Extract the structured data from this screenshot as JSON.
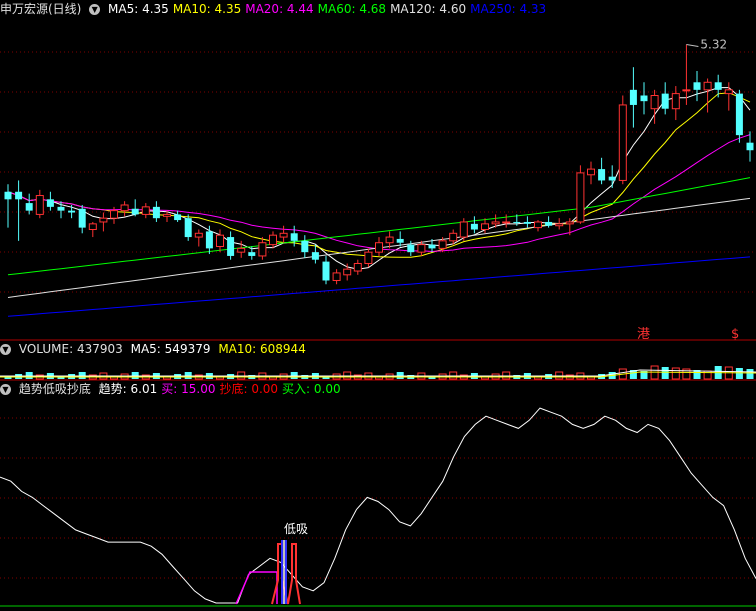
{
  "main": {
    "title": "申万宏源(日线)",
    "ma": [
      {
        "label": "MA5:",
        "value": "4.35",
        "color": "#ffffff"
      },
      {
        "label": "MA10:",
        "value": "4.35",
        "color": "#ffff00"
      },
      {
        "label": "MA20:",
        "value": "4.44",
        "color": "#ff00ff"
      },
      {
        "label": "MA60:",
        "value": "4.68",
        "color": "#00ff00"
      },
      {
        "label": "MA120:",
        "value": "4.60",
        "color": "#e0e0e0"
      },
      {
        "label": "MA250:",
        "value": "4.33",
        "color": "#0000ff"
      }
    ],
    "peak_label": "5.32",
    "badge_gang": "港",
    "badge_s": "$"
  },
  "volume": {
    "label": "VOLUME:",
    "value": "437903",
    "ma5_label": "MA5:",
    "ma5_value": "549379",
    "ma10_label": "MA10:",
    "ma10_value": "608944"
  },
  "indicator": {
    "title": "趋势低吸抄底",
    "items": [
      {
        "label": "趋势:",
        "value": "6.01",
        "color": "#ffffff"
      },
      {
        "label": "买:",
        "value": "15.00",
        "color": "#ff00ff"
      },
      {
        "label": "抄底:",
        "value": "0.00",
        "color": "#ff0000"
      },
      {
        "label": "买入:",
        "value": "0.00",
        "color": "#00ff00"
      }
    ],
    "signal_label": "低吸"
  },
  "chart_data": {
    "type": "candlestick",
    "candles": [
      {
        "o": 4.5,
        "h": 4.58,
        "l": 4.35,
        "c": 4.54,
        "up": false
      },
      {
        "o": 4.54,
        "h": 4.6,
        "l": 4.28,
        "c": 4.5,
        "up": false
      },
      {
        "o": 4.48,
        "h": 4.53,
        "l": 4.42,
        "c": 4.44,
        "up": false
      },
      {
        "o": 4.42,
        "h": 4.55,
        "l": 4.4,
        "c": 4.52,
        "up": true
      },
      {
        "o": 4.5,
        "h": 4.54,
        "l": 4.44,
        "c": 4.46,
        "up": false
      },
      {
        "o": 4.46,
        "h": 4.49,
        "l": 4.4,
        "c": 4.44,
        "up": false
      },
      {
        "o": 4.44,
        "h": 4.47,
        "l": 4.4,
        "c": 4.43,
        "up": false
      },
      {
        "o": 4.45,
        "h": 4.47,
        "l": 4.32,
        "c": 4.35,
        "up": false
      },
      {
        "o": 4.34,
        "h": 4.38,
        "l": 4.3,
        "c": 4.37,
        "up": true
      },
      {
        "o": 4.38,
        "h": 4.43,
        "l": 4.33,
        "c": 4.4,
        "up": true
      },
      {
        "o": 4.4,
        "h": 4.46,
        "l": 4.37,
        "c": 4.44,
        "up": true
      },
      {
        "o": 4.44,
        "h": 4.49,
        "l": 4.41,
        "c": 4.47,
        "up": true
      },
      {
        "o": 4.45,
        "h": 4.5,
        "l": 4.41,
        "c": 4.42,
        "up": false
      },
      {
        "o": 4.42,
        "h": 4.48,
        "l": 4.4,
        "c": 4.46,
        "up": true
      },
      {
        "o": 4.46,
        "h": 4.49,
        "l": 4.38,
        "c": 4.4,
        "up": false
      },
      {
        "o": 4.41,
        "h": 4.44,
        "l": 4.38,
        "c": 4.42,
        "up": true
      },
      {
        "o": 4.42,
        "h": 4.44,
        "l": 4.38,
        "c": 4.39,
        "up": false
      },
      {
        "o": 4.4,
        "h": 4.42,
        "l": 4.28,
        "c": 4.3,
        "up": false
      },
      {
        "o": 4.3,
        "h": 4.34,
        "l": 4.25,
        "c": 4.32,
        "up": true
      },
      {
        "o": 4.33,
        "h": 4.36,
        "l": 4.21,
        "c": 4.24,
        "up": false
      },
      {
        "o": 4.25,
        "h": 4.34,
        "l": 4.22,
        "c": 4.31,
        "up": true
      },
      {
        "o": 4.3,
        "h": 4.33,
        "l": 4.18,
        "c": 4.2,
        "up": false
      },
      {
        "o": 4.22,
        "h": 4.28,
        "l": 4.19,
        "c": 4.24,
        "up": true
      },
      {
        "o": 4.22,
        "h": 4.25,
        "l": 4.18,
        "c": 4.2,
        "up": false
      },
      {
        "o": 4.2,
        "h": 4.3,
        "l": 4.18,
        "c": 4.27,
        "up": true
      },
      {
        "o": 4.26,
        "h": 4.33,
        "l": 4.24,
        "c": 4.31,
        "up": true
      },
      {
        "o": 4.3,
        "h": 4.36,
        "l": 4.27,
        "c": 4.32,
        "up": true
      },
      {
        "o": 4.32,
        "h": 4.36,
        "l": 4.25,
        "c": 4.28,
        "up": false
      },
      {
        "o": 4.28,
        "h": 4.31,
        "l": 4.19,
        "c": 4.22,
        "up": false
      },
      {
        "o": 4.22,
        "h": 4.26,
        "l": 4.16,
        "c": 4.18,
        "up": false
      },
      {
        "o": 4.17,
        "h": 4.2,
        "l": 4.05,
        "c": 4.07,
        "up": false
      },
      {
        "o": 4.07,
        "h": 4.13,
        "l": 4.05,
        "c": 4.11,
        "up": true
      },
      {
        "o": 4.1,
        "h": 4.16,
        "l": 4.07,
        "c": 4.13,
        "up": true
      },
      {
        "o": 4.12,
        "h": 4.18,
        "l": 4.1,
        "c": 4.16,
        "up": true
      },
      {
        "o": 4.16,
        "h": 4.24,
        "l": 4.14,
        "c": 4.22,
        "up": true
      },
      {
        "o": 4.22,
        "h": 4.3,
        "l": 4.2,
        "c": 4.27,
        "up": true
      },
      {
        "o": 4.27,
        "h": 4.33,
        "l": 4.24,
        "c": 4.3,
        "up": true
      },
      {
        "o": 4.29,
        "h": 4.33,
        "l": 4.25,
        "c": 4.27,
        "up": false
      },
      {
        "o": 4.26,
        "h": 4.28,
        "l": 4.2,
        "c": 4.22,
        "up": false
      },
      {
        "o": 4.22,
        "h": 4.28,
        "l": 4.2,
        "c": 4.26,
        "up": true
      },
      {
        "o": 4.26,
        "h": 4.29,
        "l": 4.22,
        "c": 4.24,
        "up": false
      },
      {
        "o": 4.24,
        "h": 4.3,
        "l": 4.22,
        "c": 4.28,
        "up": true
      },
      {
        "o": 4.28,
        "h": 4.34,
        "l": 4.26,
        "c": 4.32,
        "up": true
      },
      {
        "o": 4.3,
        "h": 4.4,
        "l": 4.28,
        "c": 4.38,
        "up": true
      },
      {
        "o": 4.37,
        "h": 4.41,
        "l": 4.32,
        "c": 4.34,
        "up": false
      },
      {
        "o": 4.34,
        "h": 4.4,
        "l": 4.32,
        "c": 4.37,
        "up": true
      },
      {
        "o": 4.37,
        "h": 4.42,
        "l": 4.35,
        "c": 4.38,
        "up": true
      },
      {
        "o": 4.38,
        "h": 4.42,
        "l": 4.35,
        "c": 4.38,
        "up": true
      },
      {
        "o": 4.38,
        "h": 4.42,
        "l": 4.36,
        "c": 4.38,
        "up": false
      },
      {
        "o": 4.38,
        "h": 4.41,
        "l": 4.35,
        "c": 4.37,
        "up": false
      },
      {
        "o": 4.35,
        "h": 4.39,
        "l": 4.33,
        "c": 4.38,
        "up": true
      },
      {
        "o": 4.38,
        "h": 4.41,
        "l": 4.35,
        "c": 4.36,
        "up": false
      },
      {
        "o": 4.36,
        "h": 4.4,
        "l": 4.34,
        "c": 4.37,
        "up": true
      },
      {
        "o": 4.37,
        "h": 4.4,
        "l": 4.31,
        "c": 4.38,
        "up": true
      },
      {
        "o": 4.38,
        "h": 4.68,
        "l": 4.37,
        "c": 4.64,
        "up": true
      },
      {
        "o": 4.63,
        "h": 4.7,
        "l": 4.58,
        "c": 4.66,
        "up": true
      },
      {
        "o": 4.66,
        "h": 4.72,
        "l": 4.58,
        "c": 4.6,
        "up": false
      },
      {
        "o": 4.62,
        "h": 4.68,
        "l": 4.56,
        "c": 4.6,
        "up": false
      },
      {
        "o": 4.6,
        "h": 5.05,
        "l": 4.58,
        "c": 5.0,
        "up": true
      },
      {
        "o": 5.0,
        "h": 5.2,
        "l": 4.88,
        "c": 5.08,
        "up": false
      },
      {
        "o": 5.05,
        "h": 5.12,
        "l": 4.95,
        "c": 5.02,
        "up": false
      },
      {
        "o": 4.98,
        "h": 5.08,
        "l": 4.9,
        "c": 5.05,
        "up": true
      },
      {
        "o": 5.06,
        "h": 5.12,
        "l": 4.95,
        "c": 4.98,
        "up": false
      },
      {
        "o": 4.98,
        "h": 5.1,
        "l": 4.92,
        "c": 5.06,
        "up": true
      },
      {
        "o": 5.08,
        "h": 5.32,
        "l": 5.0,
        "c": 5.08,
        "up": true
      },
      {
        "o": 5.08,
        "h": 5.18,
        "l": 5.02,
        "c": 5.12,
        "up": false
      },
      {
        "o": 5.08,
        "h": 5.14,
        "l": 4.96,
        "c": 5.12,
        "up": true
      },
      {
        "o": 5.12,
        "h": 5.16,
        "l": 5.04,
        "c": 5.08,
        "up": false
      },
      {
        "o": 5.08,
        "h": 5.12,
        "l": 4.97,
        "c": 5.06,
        "up": true
      },
      {
        "o": 5.06,
        "h": 5.08,
        "l": 4.8,
        "c": 4.84,
        "up": false
      },
      {
        "o": 4.8,
        "h": 4.86,
        "l": 4.7,
        "c": 4.76,
        "up": false
      }
    ],
    "ma_series": [
      {
        "name": "MA5",
        "color": "#ffffff",
        "values": []
      },
      {
        "name": "MA10",
        "color": "#ffff00",
        "values": []
      },
      {
        "name": "MA20",
        "color": "#ff00ff",
        "values": []
      },
      {
        "name": "MA60",
        "color": "#00ff00",
        "values": []
      },
      {
        "name": "MA120",
        "color": "#e0e0e0",
        "values": []
      },
      {
        "name": "MA250",
        "color": "#0000ff",
        "values": []
      }
    ],
    "price_range": [
      3.85,
      5.45
    ],
    "trend_line": [
      62,
      60,
      55,
      52,
      48,
      44,
      40,
      36,
      34,
      32,
      30,
      30,
      30,
      30,
      28,
      24,
      18,
      12,
      6,
      2,
      0,
      0,
      0,
      14,
      18,
      22,
      20,
      14,
      8,
      6,
      10,
      22,
      36,
      46,
      52,
      50,
      46,
      40,
      38,
      44,
      52,
      60,
      72,
      82,
      88,
      92,
      90,
      88,
      86,
      90,
      96,
      94,
      92,
      88,
      86,
      88,
      92,
      90,
      86,
      84,
      88,
      86,
      80,
      72,
      64,
      58,
      52,
      48,
      36,
      22,
      12
    ],
    "trend_range": [
      0,
      100
    ]
  }
}
